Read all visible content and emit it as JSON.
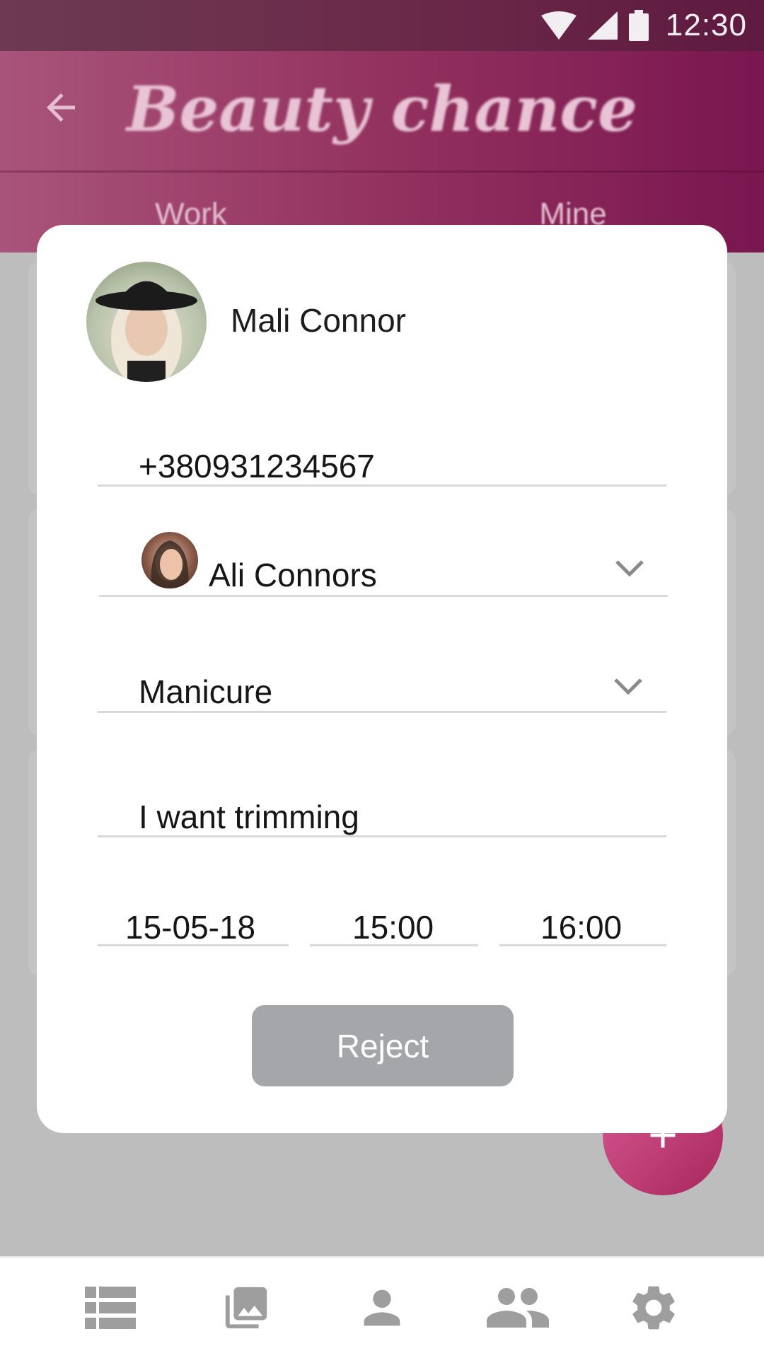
{
  "status_bar": {
    "time": "12:30",
    "icons": [
      "wifi-icon",
      "signal-icon",
      "battery-icon"
    ]
  },
  "app_bar": {
    "title": "Beauty chance",
    "back_icon": "arrow-back-icon"
  },
  "tabs": [
    {
      "label": "Work"
    },
    {
      "label": "Mine"
    }
  ],
  "dialog": {
    "client_name": "Mali Connor",
    "phone": "+380931234567",
    "master": {
      "name": "Ali Connors"
    },
    "service": "Manicure",
    "comment": "I want trimming",
    "date": "15-05-18",
    "time_start": "15:00",
    "time_end": "16:00",
    "reject_label": "Reject"
  },
  "fab": {
    "icon": "plus-icon"
  },
  "bottom_nav": [
    {
      "icon": "list-icon"
    },
    {
      "icon": "photo-library-icon"
    },
    {
      "icon": "person-icon"
    },
    {
      "icon": "people-icon"
    },
    {
      "icon": "settings-gear-icon"
    }
  ],
  "colors": {
    "accent": "#8e2a5c",
    "scrim": "#bdbdbd",
    "button_disabled": "#a5a6aa",
    "icon_grey": "#9e9e9e"
  }
}
